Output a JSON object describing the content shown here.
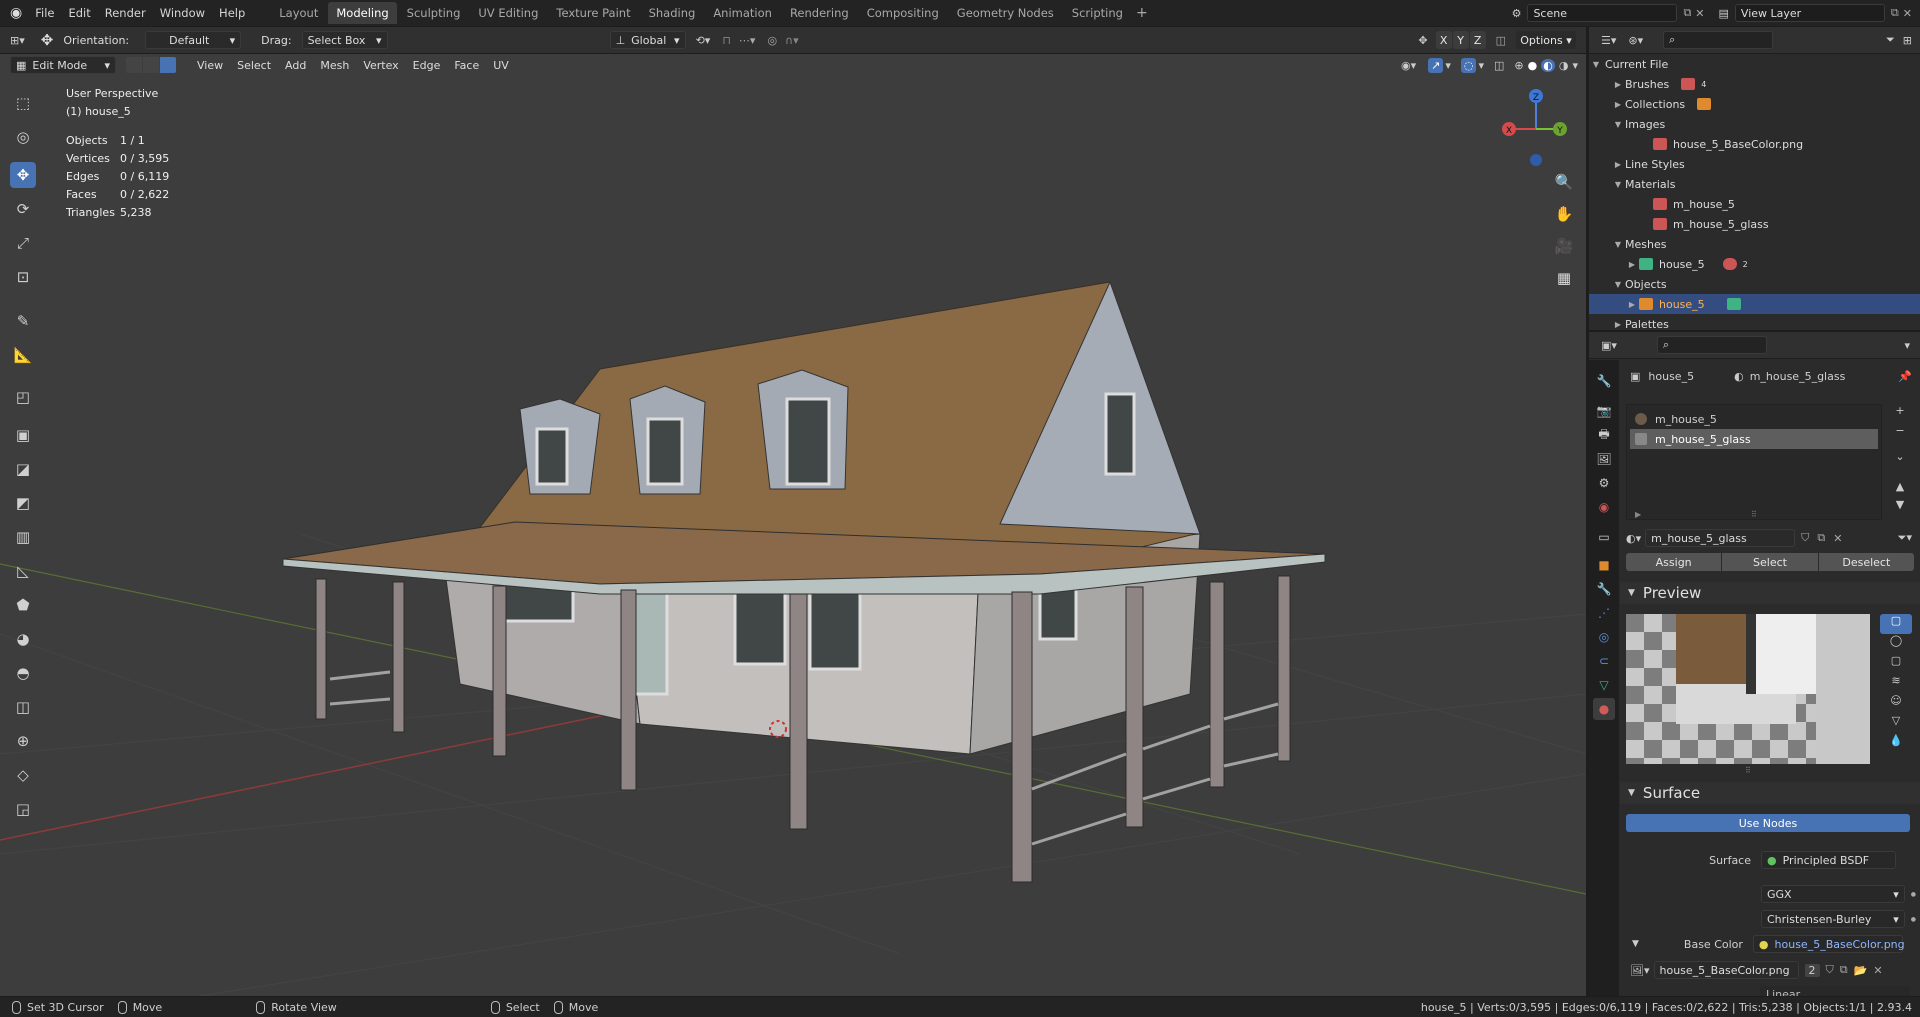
{
  "topbar": {
    "menus": [
      "File",
      "Edit",
      "Render",
      "Window",
      "Help"
    ],
    "workspaces": [
      "Layout",
      "Modeling",
      "Sculpting",
      "UV Editing",
      "Texture Paint",
      "Shading",
      "Animation",
      "Rendering",
      "Compositing",
      "Geometry Nodes",
      "Scripting"
    ],
    "active_workspace": "Modeling",
    "scene": "Scene",
    "view_layer": "View Layer"
  },
  "tool_header": {
    "orientation_label": "Orientation:",
    "orientation_value": "Default",
    "drag_label": "Drag:",
    "drag_value": "Select Box",
    "transform_orientation": "Global",
    "axes": [
      "X",
      "Y",
      "Z"
    ],
    "options": "Options"
  },
  "view_header": {
    "mode": "Edit Mode",
    "menus": [
      "View",
      "Select",
      "Add",
      "Mesh",
      "Vertex",
      "Edge",
      "Face",
      "UV"
    ]
  },
  "overlay": {
    "perspective": "User Perspective",
    "object_name": "(1) house_5",
    "stats": [
      {
        "label": "Objects",
        "value": "1 / 1"
      },
      {
        "label": "Vertices",
        "value": "0 / 3,595"
      },
      {
        "label": "Edges",
        "value": "0 / 6,119"
      },
      {
        "label": "Faces",
        "value": "0 / 2,622"
      },
      {
        "label": "Triangles",
        "value": "5,238"
      }
    ]
  },
  "gizmo": {
    "x": "X",
    "y": "Y",
    "z": "Z"
  },
  "outliner": {
    "root": "Current File",
    "brushes_count": "4",
    "rows": [
      {
        "label": "Brushes",
        "indent": 1,
        "expanded": false
      },
      {
        "label": "Collections",
        "indent": 1,
        "expanded": false
      },
      {
        "label": "Images",
        "indent": 1,
        "expanded": true
      },
      {
        "label": "house_5_BaseColor.png",
        "indent": 3,
        "expanded": null
      },
      {
        "label": "Line Styles",
        "indent": 1,
        "expanded": false
      },
      {
        "label": "Materials",
        "indent": 1,
        "expanded": true
      },
      {
        "label": "m_house_5",
        "indent": 3,
        "expanded": null
      },
      {
        "label": "m_house_5_glass",
        "indent": 3,
        "expanded": null
      },
      {
        "label": "Meshes",
        "indent": 1,
        "expanded": true
      },
      {
        "label": "house_5",
        "indent": 2,
        "expanded": false
      },
      {
        "label": "Objects",
        "indent": 1,
        "expanded": true
      },
      {
        "label": "house_5",
        "indent": 2,
        "expanded": false
      },
      {
        "label": "Palettes",
        "indent": 1,
        "expanded": false
      }
    ],
    "mesh_users": "2"
  },
  "properties": {
    "object": "house_5",
    "material": "m_house_5_glass",
    "slots": [
      "m_house_5",
      "m_house_5_glass"
    ],
    "material_field": "m_house_5_glass",
    "assign": "Assign",
    "select": "Select",
    "deselect": "Deselect",
    "preview": "Preview",
    "surface_header": "Surface",
    "use_nodes": "Use Nodes",
    "surface_label": "Surface",
    "surface_value": "Principled BSDF",
    "distribution": "GGX",
    "subsurface": "Christensen-Burley",
    "base_color_label": "Base Color",
    "base_color_value": "house_5_BaseColor.png",
    "image_field": "house_5_BaseColor.png",
    "image_users": "2",
    "interpolation": "Linear"
  },
  "statusbar": {
    "left": [
      {
        "label": "Set 3D Cursor"
      },
      {
        "label": "Move"
      },
      {
        "label": "Rotate View"
      },
      {
        "label": "Select"
      },
      {
        "label": "Move"
      }
    ],
    "right": "house_5 | Verts:0/3,595 | Edges:0/6,119 | Faces:0/2,622 | Tris:5,238 | Objects:1/1 | 2.93.4"
  },
  "colors": {
    "accent": "#4772b3",
    "viewport_bg": "#3d3d3d",
    "panel_bg": "#2b2b2b",
    "roof": "#8a6a45",
    "siding": "#b6b4b3",
    "selected_row": "#334d80"
  }
}
